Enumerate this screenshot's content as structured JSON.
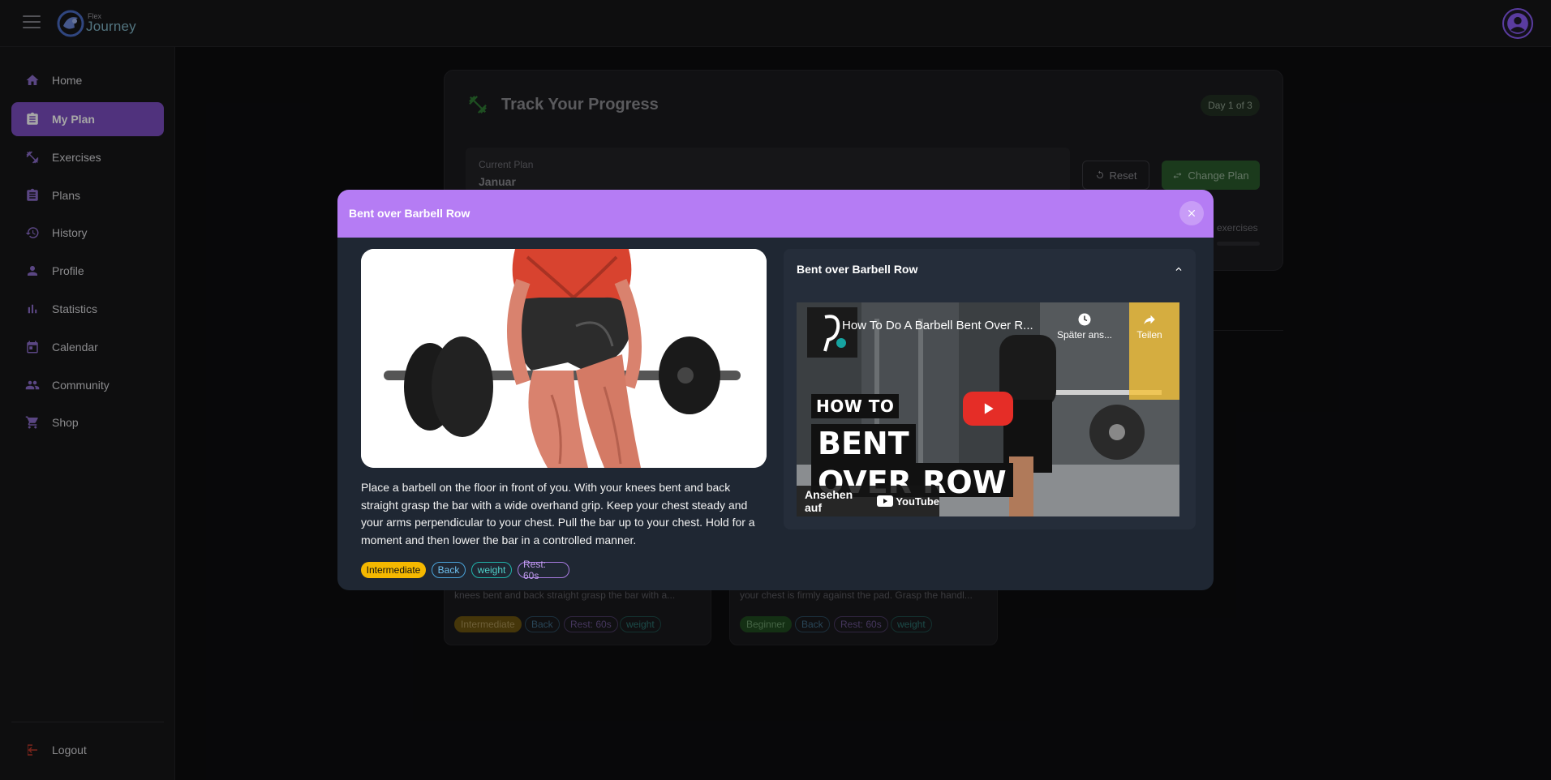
{
  "app": {
    "logo_small": "Flex",
    "logo_big": "Journey"
  },
  "sidebar": {
    "items": [
      {
        "label": "Home",
        "icon": "home-icon"
      },
      {
        "label": "My Plan",
        "icon": "clipboard-icon"
      },
      {
        "label": "Exercises",
        "icon": "dumbbell-icon"
      },
      {
        "label": "Plans",
        "icon": "list-icon"
      },
      {
        "label": "History",
        "icon": "history-icon"
      },
      {
        "label": "Profile",
        "icon": "person-icon"
      },
      {
        "label": "Statistics",
        "icon": "bar-chart-icon"
      },
      {
        "label": "Calendar",
        "icon": "calendar-icon"
      },
      {
        "label": "Community",
        "icon": "people-icon"
      },
      {
        "label": "Shop",
        "icon": "cart-icon"
      }
    ],
    "active": "My Plan",
    "logout": "Logout"
  },
  "background": {
    "title": "Track Your Progress",
    "day_pill": "Day 1 of 3",
    "current_plan_label": "Current Plan",
    "current_plan_value": "Januar",
    "reset_label": "Reset",
    "change_label": "Change Plan",
    "exercises_label": "exercises",
    "cards": [
      {
        "desc": "knees bent and back straight grasp the bar with a...",
        "chips": [
          "Intermediate",
          "Back",
          "Rest: 60s",
          "weight"
        ]
      },
      {
        "desc": "your chest is firmly against the pad. Grasp the handl...",
        "chips": [
          "Beginner",
          "Back",
          "Rest: 60s",
          "weight"
        ]
      }
    ]
  },
  "modal": {
    "title": "Bent over Barbell Row",
    "description": "Place a barbell on the floor in front of you. With your knees bent and back straight grasp the bar with a wide overhand grip. Keep your chest steady and your arms perpendicular to your chest. Pull the bar up to your chest. Hold for a moment and then lower the bar in a controlled manner.",
    "chips": [
      "Intermediate",
      "Back",
      "weight",
      "Rest: 60s"
    ],
    "accordion_title": "Bent over Barbell Row",
    "video": {
      "title": "How To Do A Barbell Bent Over R...",
      "watch_later": "Später ans...",
      "share": "Teilen",
      "overlay_line1": "HOW TO",
      "overlay_line2": "BENT",
      "overlay_line3": "OVER ROW",
      "watch_on": "Ansehen auf",
      "youtube": "YouTube"
    }
  },
  "colors": {
    "accent": "#b57cf4",
    "active_nav": "#7c4ec0",
    "intermediate": "#f5b800",
    "back": "#4aa3d9",
    "weight": "#20b2aa",
    "rest": "#a77be0"
  }
}
